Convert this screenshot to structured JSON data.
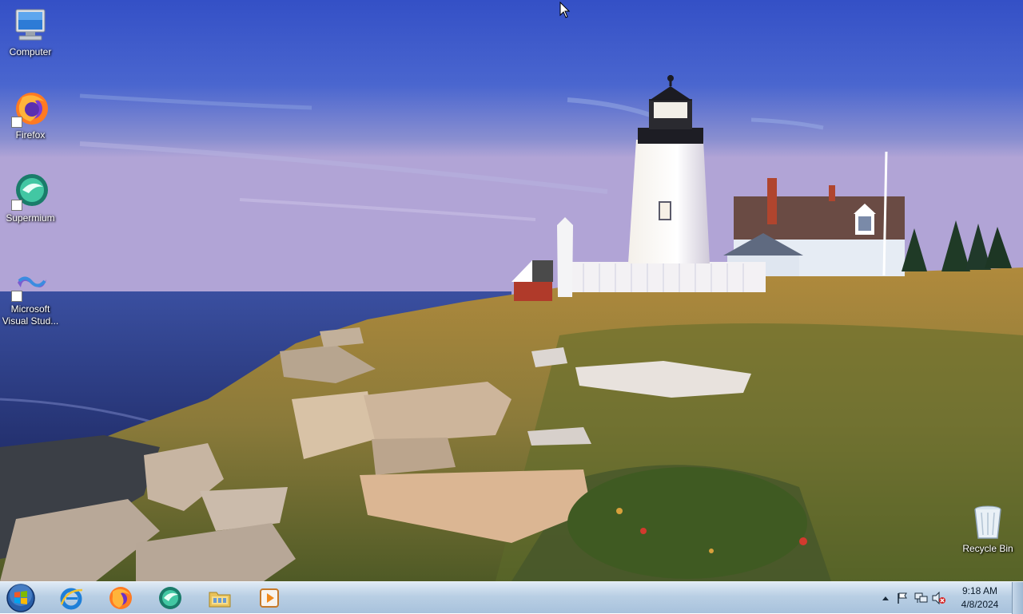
{
  "desktop": {
    "icons": [
      {
        "label": "Computer",
        "icon": "computer-icon"
      },
      {
        "label": "Firefox",
        "icon": "firefox-icon"
      },
      {
        "label": "Supermium",
        "icon": "supermium-icon"
      },
      {
        "label": "Microsoft Visual Stud...",
        "icon": "visual-studio-icon"
      },
      {
        "label": "Recycle Bin",
        "icon": "recycle-bin-icon"
      }
    ]
  },
  "taskbar": {
    "start_icon": "windows-logo-icon",
    "pinned": [
      {
        "icon": "internet-explorer-icon"
      },
      {
        "icon": "firefox-icon"
      },
      {
        "icon": "supermium-icon"
      },
      {
        "icon": "file-explorer-icon"
      },
      {
        "icon": "media-player-icon"
      }
    ]
  },
  "tray": {
    "icons": [
      "show-hidden-icons-chevron",
      "action-center-flag-icon",
      "network-icon",
      "volume-muted-icon"
    ],
    "time": "9:18 AM",
    "date": "4/8/2024"
  }
}
